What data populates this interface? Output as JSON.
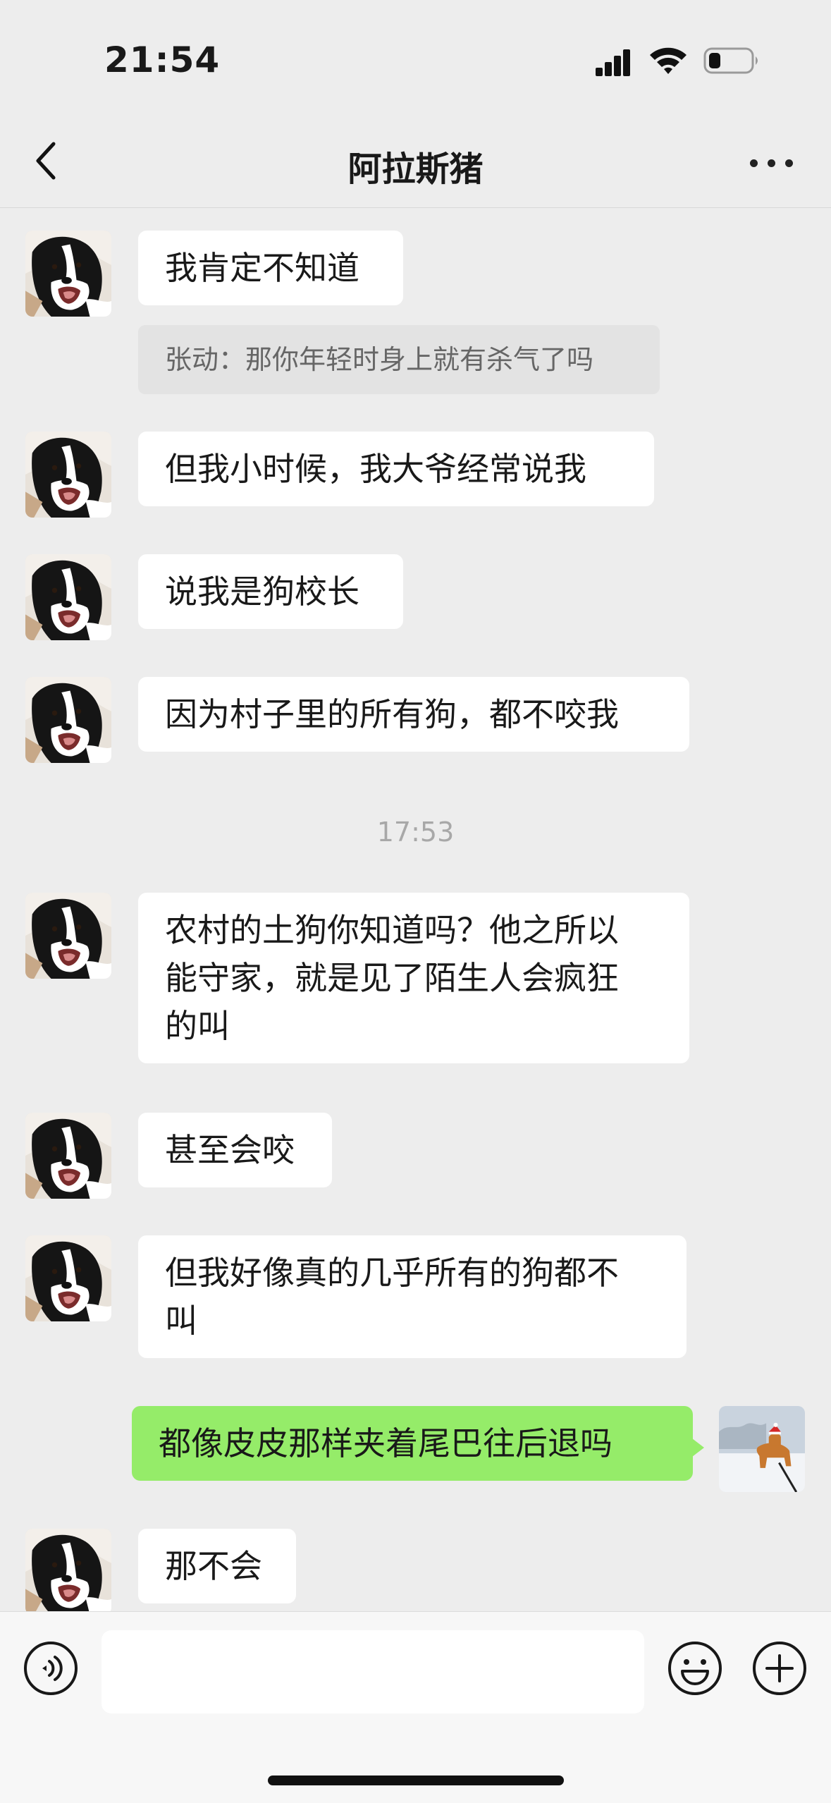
{
  "status_bar": {
    "time": "21:54"
  },
  "header": {
    "title": "阿拉斯猪"
  },
  "messages": {
    "m1": {
      "sender": "contact",
      "lines": [
        "我肯定不知道"
      ]
    },
    "quote1": {
      "text": "张动：那你年轻时身上就有杀气了吗"
    },
    "m2": {
      "sender": "contact",
      "lines": [
        "但我小时候，我大爷经常说我"
      ]
    },
    "m3": {
      "sender": "contact",
      "lines": [
        "说我是狗校长"
      ]
    },
    "m4": {
      "sender": "contact",
      "lines": [
        "因为村子里的所有狗，都不咬我"
      ]
    },
    "time_sep": "17:53",
    "m5": {
      "sender": "contact",
      "lines": [
        "农村的土狗你知道吗？他之所以",
        "能守家，就是见了陌生人会疯狂",
        "的叫"
      ]
    },
    "m6": {
      "sender": "contact",
      "lines": [
        "甚至会咬"
      ]
    },
    "m7": {
      "sender": "contact",
      "lines": [
        "但我好像真的几乎所有的狗都不",
        "叫"
      ]
    },
    "m8": {
      "sender": "me",
      "lines": [
        "都像皮皮那样夹着尾巴往后退吗"
      ]
    },
    "m9": {
      "sender": "contact",
      "lines": [
        "那不会"
      ]
    }
  },
  "input_bar": {
    "value": "",
    "placeholder": ""
  },
  "icons": {
    "back": "back-chevron-icon",
    "more": "more-dots-icon",
    "voice": "voice-icon",
    "emoji": "emoji-icon",
    "plus": "plus-icon",
    "contact_avatar": "border-collie-avatar",
    "my_avatar": "shiba-snow-avatar"
  },
  "colors": {
    "background": "#ededed",
    "contact_bubble": "#ffffff",
    "my_bubble": "#95ec69",
    "quote_bg": "#e3e3e3"
  }
}
